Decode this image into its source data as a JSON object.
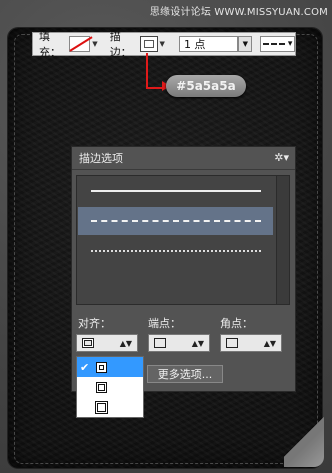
{
  "watermark": "思缘设计论坛 WWW.MISSYUAN.COM",
  "toolbar": {
    "fill_label": "填充：",
    "stroke_label": "描边：",
    "stroke_width": "1 点",
    "fill_color": "#ff0000",
    "stroke_color": "#5a5a5a"
  },
  "callout": {
    "color_value": "#5a5a5a"
  },
  "panel": {
    "title": "描边选项",
    "selected_style_index": 1,
    "styles": [
      "solid",
      "dashed",
      "dotted"
    ],
    "align_label": "对齐：",
    "caps_label": "端点：",
    "corners_label": "角点：",
    "more_button": "更多选项..."
  },
  "align_menu": {
    "options": [
      "inside",
      "center",
      "outside"
    ],
    "selected": "inside",
    "highlight_color": "#3399ff"
  }
}
